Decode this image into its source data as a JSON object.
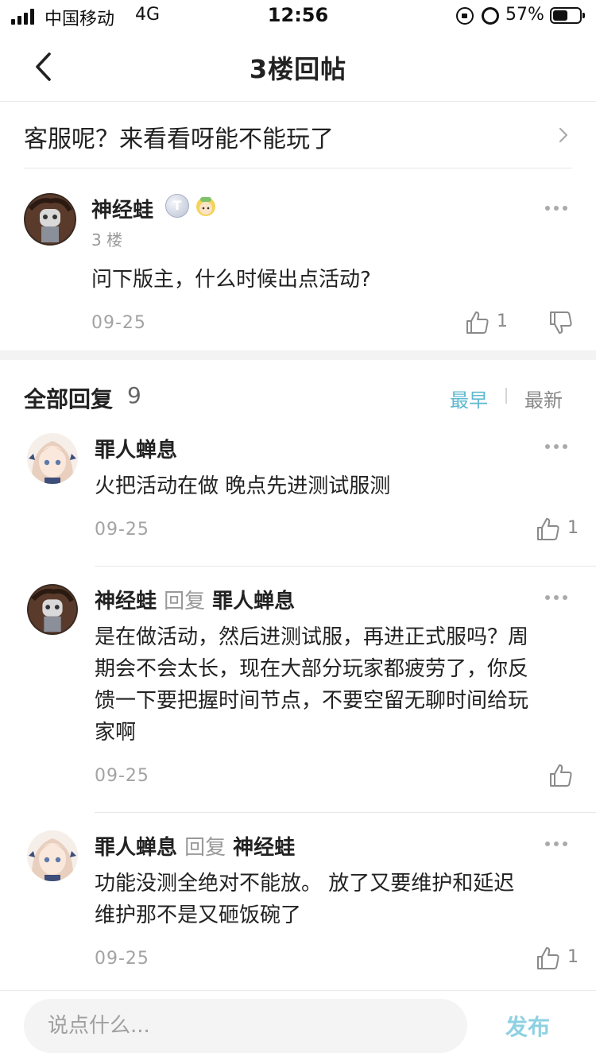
{
  "status_bar": {
    "carrier": "中国移动",
    "network": "4G",
    "time": "12:56",
    "battery_percent": "57%",
    "battery_level": 0.57
  },
  "nav": {
    "title": "3楼回帖",
    "back_icon": "chevron-left-icon"
  },
  "topic": {
    "text": "客服呢？来看看呀能不能玩了",
    "icon": "chevron-right-icon"
  },
  "floor_post": {
    "author": "神经蛙",
    "badge_label": "T",
    "floor": "3 楼",
    "content": "问下版主，什么时候出点活动?",
    "date": "09-25",
    "likes": "1",
    "icons": [
      "more-icon",
      "thumbs-up-icon",
      "thumbs-down-icon"
    ]
  },
  "replies_header": {
    "title": "全部回复",
    "count": "9",
    "sort_earliest": "最早",
    "sort_newest": "最新"
  },
  "replies": [
    {
      "author": "罪人蝉息",
      "reply_to_label": "",
      "reply_to_name": "",
      "lines": [
        "火把活动在做 晚点先进测试服测"
      ],
      "date": "09-25",
      "likes": "1"
    },
    {
      "author": "神经蛙",
      "reply_to_label": "回复",
      "reply_to_name": "罪人蝉息",
      "lines": [
        "是在做活动，然后进测试服，再进正式服吗？周",
        "期会不会太长，现在大部分玩家都疲劳了，你反",
        "馈一下要把握时间节点，不要空留无聊时间给玩",
        "家啊"
      ],
      "date": "09-25",
      "likes": ""
    },
    {
      "author": "罪人蝉息",
      "reply_to_label": "回复",
      "reply_to_name": "神经蛙",
      "lines": [
        "功能没测全绝对不能放。 放了又要维护和延迟",
        "维护那不是又砸饭碗了"
      ],
      "date": "09-25",
      "likes": "1"
    }
  ],
  "composer": {
    "placeholder": "说点什么...",
    "send_label": "发布"
  },
  "colors": {
    "accent": "#5eb8cf",
    "send_disabled": "#8ed1e3",
    "muted_text": "#999999",
    "divider": "#e8e8e8"
  }
}
